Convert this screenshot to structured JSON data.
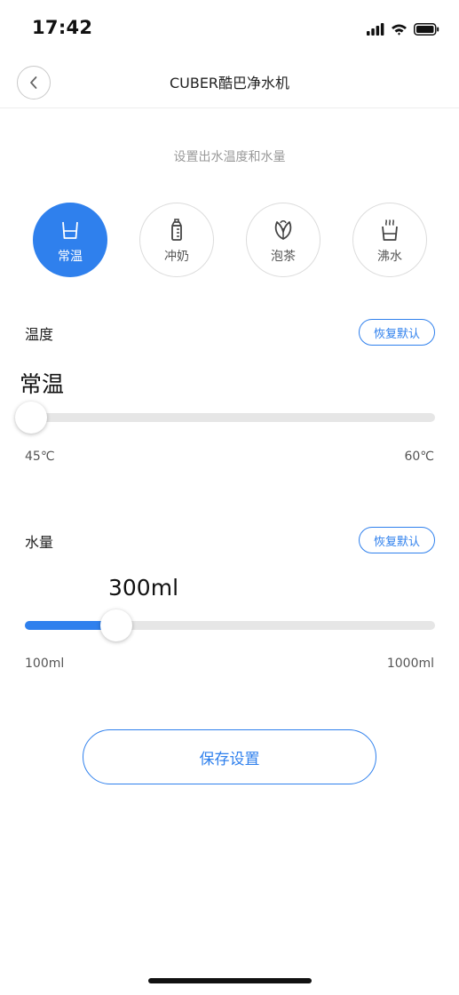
{
  "status_bar": {
    "time": "17:42",
    "icons": [
      "signal-icon",
      "wifi-icon",
      "battery-icon"
    ]
  },
  "nav": {
    "title": "CUBER酷巴净水机",
    "back_icon": "chevron-left-icon"
  },
  "subtitle": "设置出水温度和水量",
  "modes": [
    {
      "label": "常温",
      "icon": "cup-icon",
      "active": true
    },
    {
      "label": "冲奶",
      "icon": "baby-bottle-icon",
      "active": false
    },
    {
      "label": "泡茶",
      "icon": "tea-leaf-icon",
      "active": false
    },
    {
      "label": "沸水",
      "icon": "boiling-water-icon",
      "active": false
    }
  ],
  "temperature": {
    "label": "温度",
    "reset_label": "恢复默认",
    "value_text": "常温",
    "min_label": "45℃",
    "max_label": "60℃",
    "position": 0.0
  },
  "water": {
    "label": "水量",
    "reset_label": "恢复默认",
    "value_text": "300ml",
    "min_label": "100ml",
    "max_label": "1000ml",
    "min": 100,
    "max": 1000,
    "value": 300
  },
  "save_label": "保存设置",
  "colors": {
    "accent": "#2f80ed",
    "track": "#e6e6e6",
    "muted_text": "#9a9a9a"
  }
}
